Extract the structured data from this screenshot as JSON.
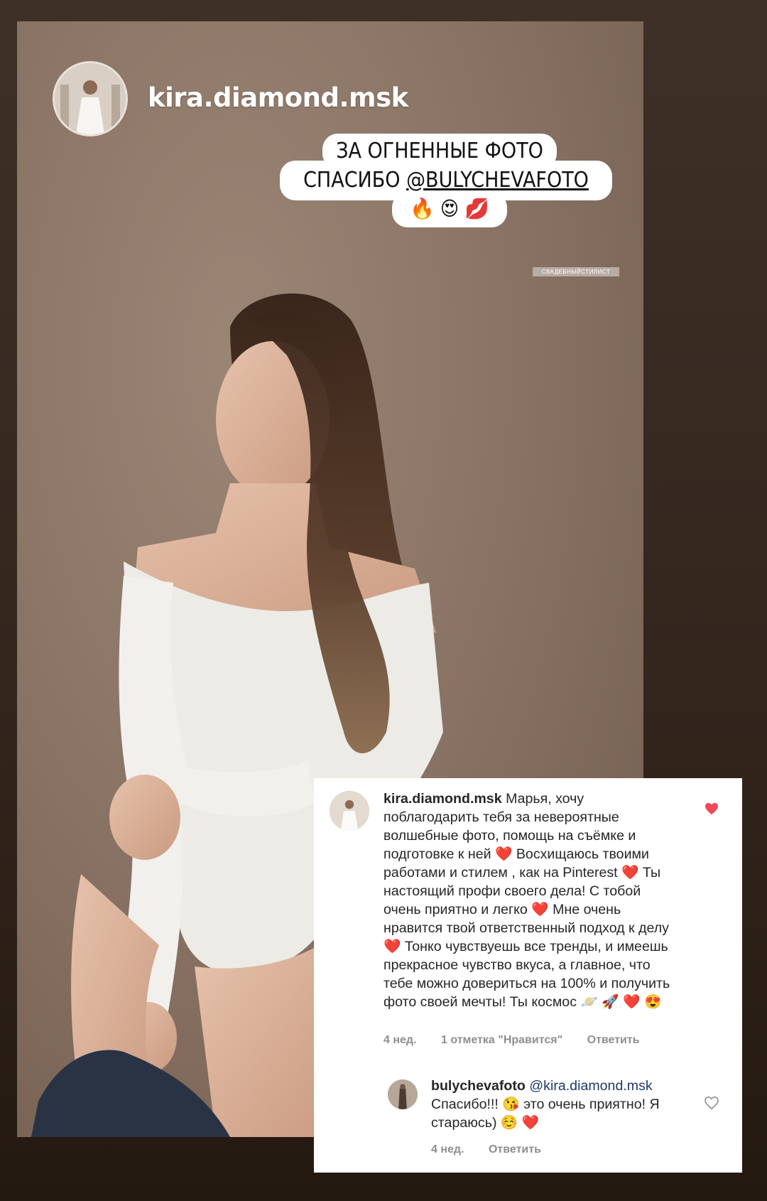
{
  "story": {
    "username": "kira.diamond.msk",
    "sticker_line1": "ЗА ОГНЕННЫЕ ФОТО",
    "sticker_line2_prefix": "СПАСИБО ",
    "sticker_mention": "@BULYCHEVAFOTO",
    "sticker_emojis": "🔥 😍 💋",
    "tag": "СВАДЕБНЫЙСТИЛИСТ"
  },
  "comment": {
    "username": "kira.diamond.msk",
    "text": "Марья, хочу поблагодарить тебя за невероятные волшебные фото, помощь на съёмке и подготовке к ней ❤️ Восхищаюсь твоими работами и стилем , как на Pinterest ❤️ Ты настоящий профи своего дела! С тобой очень приятно и легко ❤️ Мне очень нравится твой ответственный подход к делу ❤️ Тонко чувствуешь все тренды, и имеешь прекрасное чувство вкуса, а главное, что тебе можно довериться на 100% и получить фото своей мечты! Ты космос 🪐 🚀 ❤️ 😍",
    "time": "4 нед.",
    "likes": "1 отметка \"Нравится\"",
    "reply_label": "Ответить"
  },
  "reply": {
    "username": "bulychevafoto",
    "mention": "@kira.diamond.msk",
    "text": "Спасибо!!! 😘 это очень приятно! Я стараюсь) ☺️ ❤️",
    "time": "4 нед.",
    "reply_label": "Ответить"
  },
  "colors": {
    "background": "#33261d",
    "heart_liked": "#ed4956",
    "meta_gray": "#8e8e8e",
    "mention_blue": "#1f3a6b"
  }
}
